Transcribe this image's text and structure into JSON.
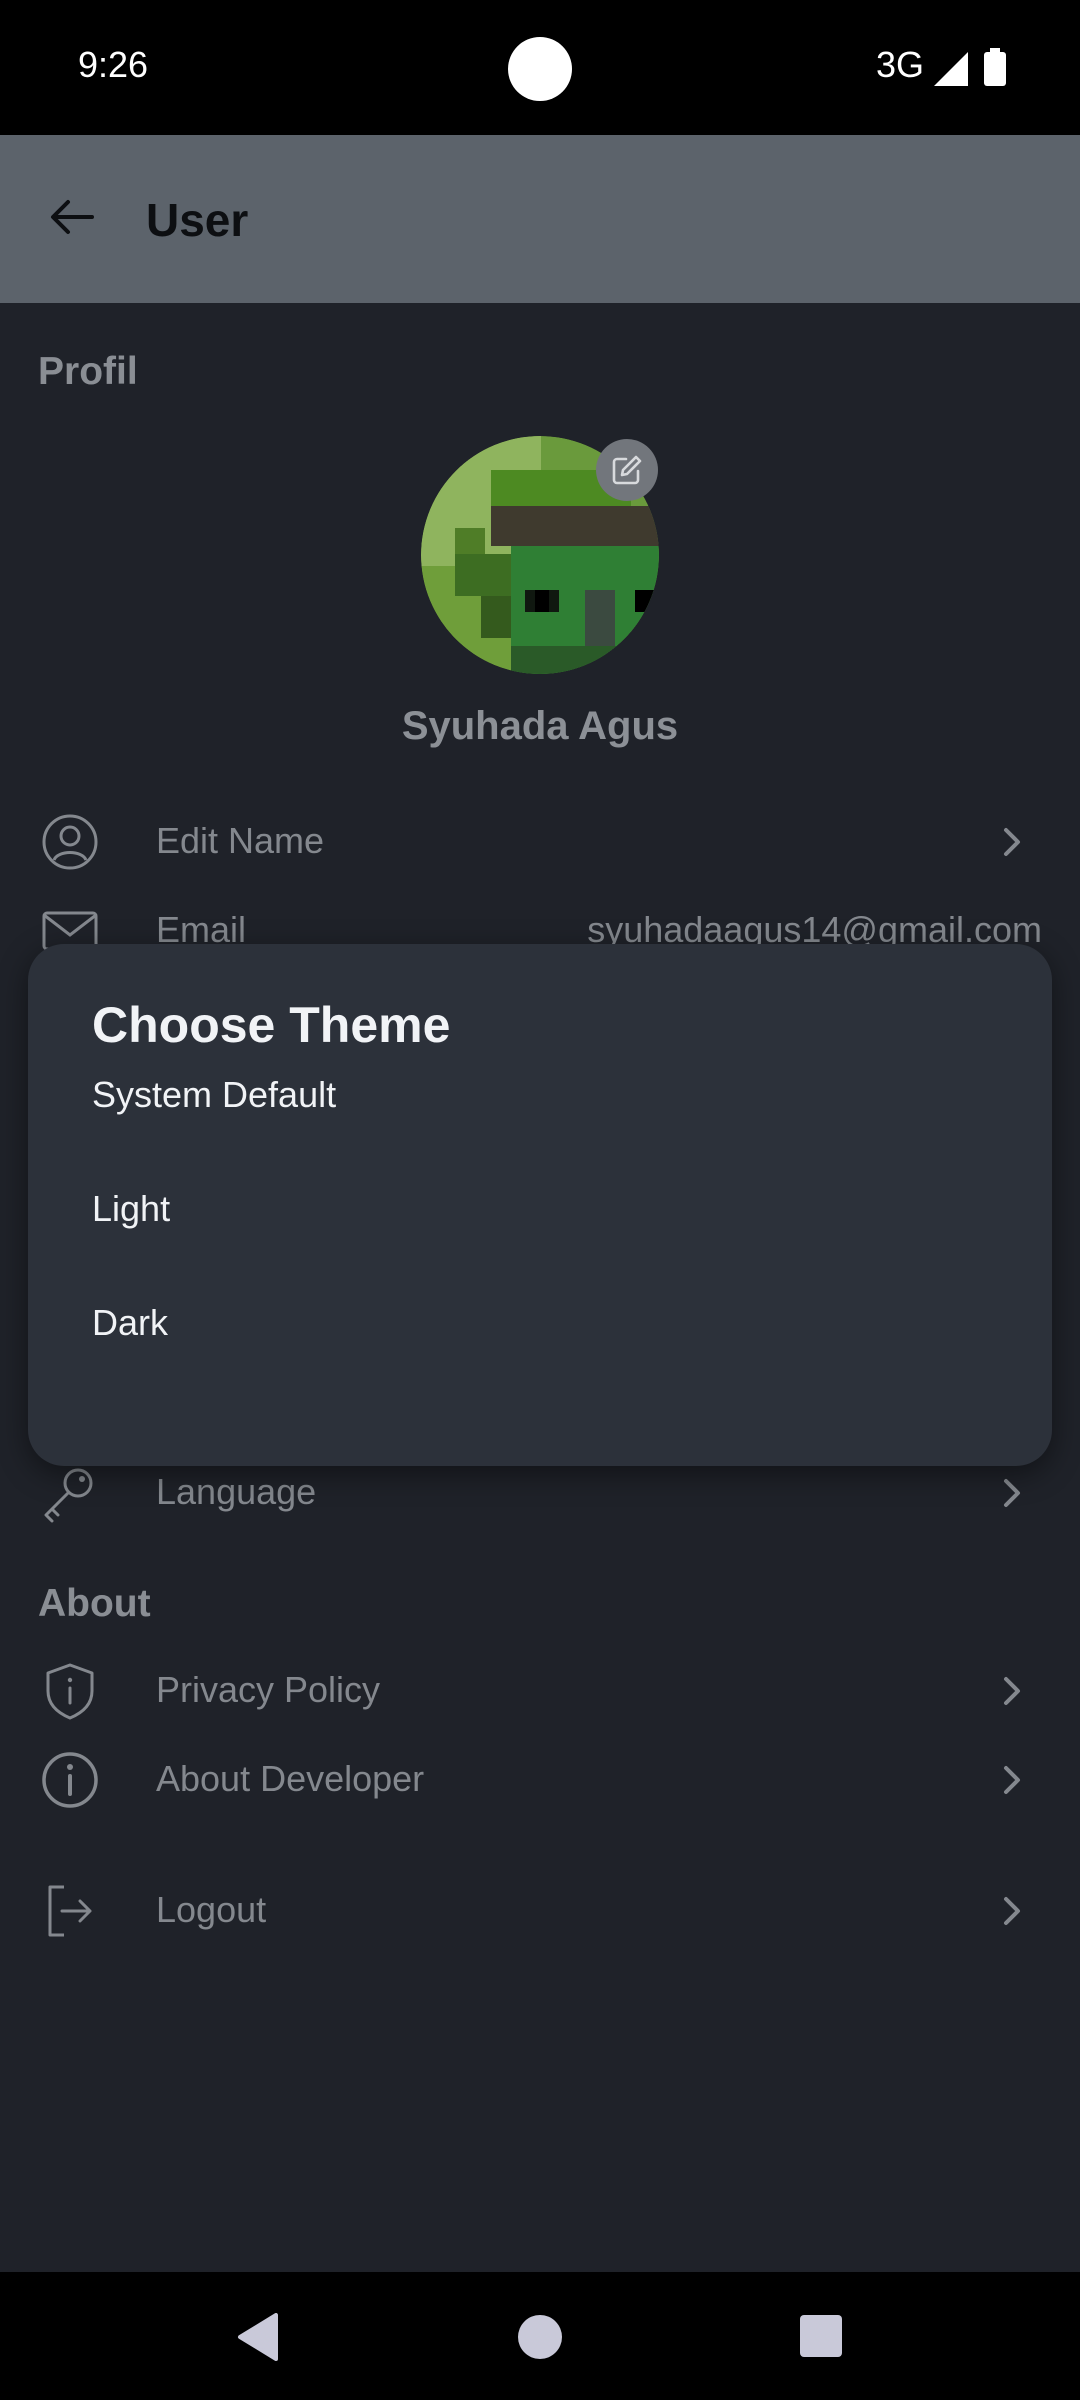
{
  "status_bar": {
    "time": "9:26",
    "network": "3G"
  },
  "app_bar": {
    "title": "User"
  },
  "profile": {
    "section_title": "Profil",
    "name": "Syuhada Agus",
    "edit_name_label": "Edit Name",
    "email_label": "Email",
    "email_value": "syuhadaagus14@gmail.com"
  },
  "settings": {
    "language_label": "Language"
  },
  "about": {
    "section_title": "About",
    "privacy_label": "Privacy Policy",
    "developer_label": "About Developer"
  },
  "logout_label": "Logout",
  "dialog": {
    "title": "Choose Theme",
    "options": [
      "System Default",
      "Light",
      "Dark"
    ]
  },
  "icons": {
    "back": "arrow-left-icon",
    "edit_avatar": "pencil-square-icon",
    "edit_name": "user-circle-icon",
    "email": "envelope-icon",
    "language": "key-icon",
    "privacy": "shield-icon",
    "developer": "info-circle-icon",
    "logout": "logout-icon",
    "row_action": "chevron-right-icon"
  },
  "colors": {
    "app_bar": "#5c636b",
    "background": "#1f2229",
    "dialog": "#2c313a",
    "muted_text": "#84888e"
  }
}
